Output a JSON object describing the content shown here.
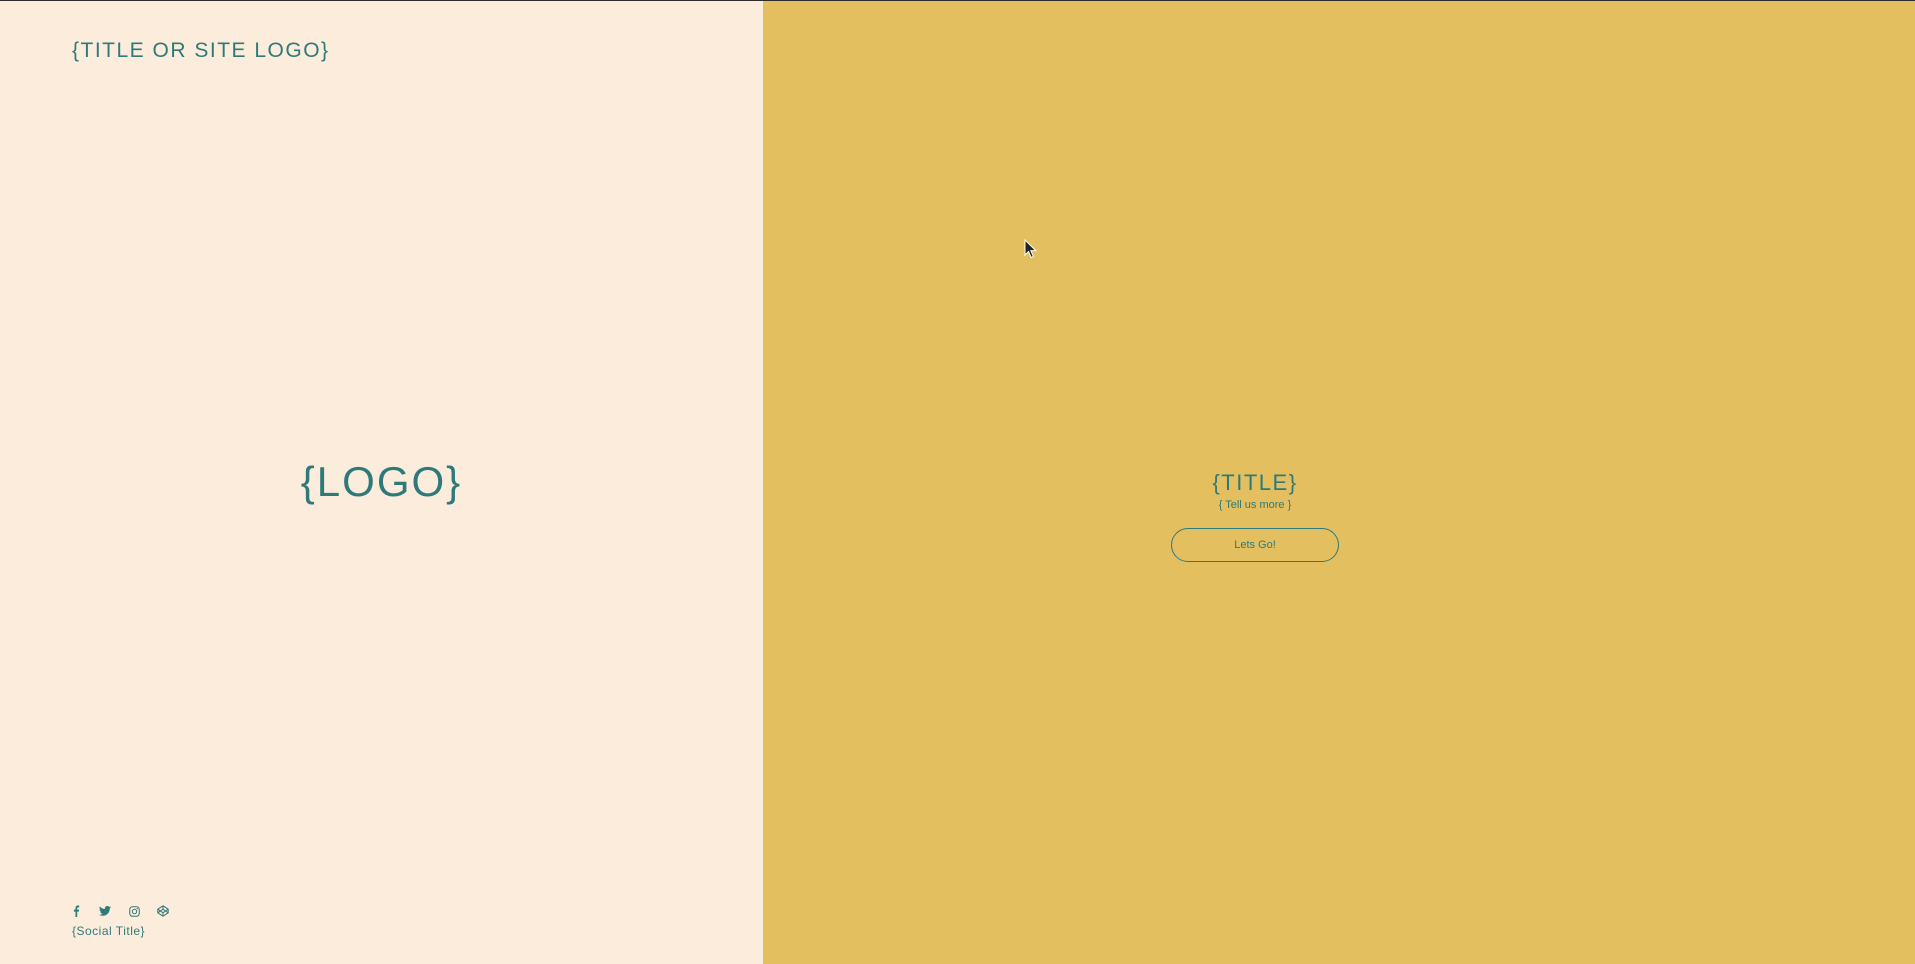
{
  "header": {
    "site_title": "{TITLE OR SITE LOGO}"
  },
  "hero": {
    "logo_text": "{LOGO}"
  },
  "cta": {
    "title": "{TITLE}",
    "subtitle": "{ Tell us more }",
    "button_label": "Lets Go!"
  },
  "social": {
    "title": "{Social Title}",
    "icons": [
      "facebook-icon",
      "twitter-icon",
      "instagram-icon",
      "codepen-icon"
    ]
  },
  "colors": {
    "left_background": "#fbecdb",
    "right_background": "#e3bf5f",
    "accent_text": "#2e7a7a"
  }
}
